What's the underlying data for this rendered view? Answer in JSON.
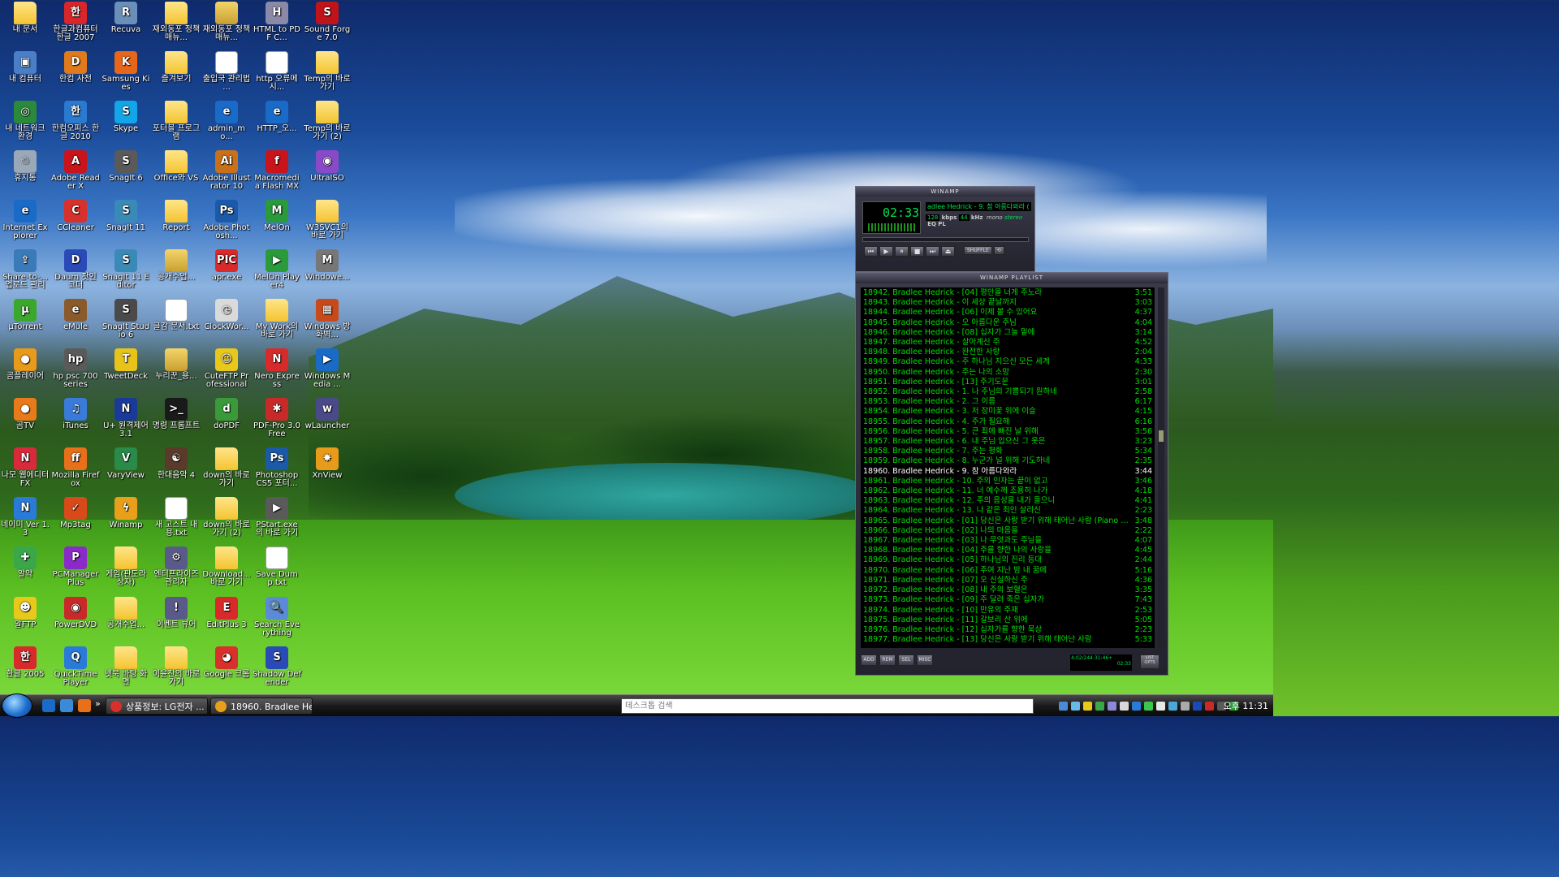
{
  "desktop": {
    "icons": [
      {
        "label": "내 문서",
        "kind": "folder"
      },
      {
        "label": "한글과컴퓨터 한글 2007",
        "kind": "app",
        "color": "#d8262a",
        "glyph": "한"
      },
      {
        "label": "Recuva",
        "kind": "app",
        "color": "#6a8fb8",
        "glyph": "R"
      },
      {
        "label": "재외동포 정책 매뉴...",
        "kind": "folder"
      },
      {
        "label": "재외동포 정책 매뉴...",
        "kind": "zip"
      },
      {
        "label": "HTML to PDF C...",
        "kind": "app",
        "color": "#8a8aa8",
        "glyph": "H"
      },
      {
        "label": "Sound Forge 7.0",
        "kind": "app",
        "color": "#c0141a",
        "glyph": "S"
      },
      {
        "label": "내 컴퓨터",
        "kind": "app",
        "color": "#4a7fc8",
        "glyph": "▣"
      },
      {
        "label": "한컴 사전",
        "kind": "app",
        "color": "#e07a1a",
        "glyph": "D"
      },
      {
        "label": "Samsung Kies",
        "kind": "app",
        "color": "#e8661a",
        "glyph": "K"
      },
      {
        "label": "즐겨보기",
        "kind": "folder"
      },
      {
        "label": "출입국 관리법 ...",
        "kind": "doc"
      },
      {
        "label": "http 오류메시...",
        "kind": "doc"
      },
      {
        "label": "Temp의 바로 가기",
        "kind": "folder"
      },
      {
        "label": "내 네트워크 환경",
        "kind": "app",
        "color": "#2a8a3a",
        "glyph": "◎"
      },
      {
        "label": "한컴오피스 한글 2010",
        "kind": "app",
        "color": "#2a7ad0",
        "glyph": "한"
      },
      {
        "label": "Skype",
        "kind": "app",
        "color": "#12a5e8",
        "glyph": "S"
      },
      {
        "label": "포터블 프로그램",
        "kind": "folder"
      },
      {
        "label": "admin_mo...",
        "kind": "app",
        "color": "#1a6ac8",
        "glyph": "e"
      },
      {
        "label": "HTTP_오...",
        "kind": "app",
        "color": "#1a6ac8",
        "glyph": "e"
      },
      {
        "label": "Temp의 바로 가기 (2)",
        "kind": "folder"
      },
      {
        "label": "휴지통",
        "kind": "app",
        "color": "#9aa8b8",
        "glyph": "♲"
      },
      {
        "label": "Adobe Reader X",
        "kind": "app",
        "color": "#c8141a",
        "glyph": "A"
      },
      {
        "label": "SnagIt 6",
        "kind": "app",
        "color": "#5a5a5a",
        "glyph": "S"
      },
      {
        "label": "Office와 VS",
        "kind": "folder"
      },
      {
        "label": "Adobe Illustrator 10",
        "kind": "app",
        "color": "#c8701a",
        "glyph": "Ai"
      },
      {
        "label": "Macromedia Flash MX",
        "kind": "app",
        "color": "#c8141a",
        "glyph": "f"
      },
      {
        "label": "UltraISO",
        "kind": "app",
        "color": "#8a4ac8",
        "glyph": "◉"
      },
      {
        "label": "Internet Explorer",
        "kind": "app",
        "color": "#1a6ac8",
        "glyph": "e"
      },
      {
        "label": "CCleaner",
        "kind": "app",
        "color": "#d8302a",
        "glyph": "C"
      },
      {
        "label": "SnagIt 11",
        "kind": "app",
        "color": "#3a8ab8",
        "glyph": "S"
      },
      {
        "label": "Report",
        "kind": "folder"
      },
      {
        "label": "Adobe Photosh...",
        "kind": "app",
        "color": "#1a5aa8",
        "glyph": "Ps"
      },
      {
        "label": "MelOn",
        "kind": "app",
        "color": "#2a9a3a",
        "glyph": "M"
      },
      {
        "label": "W3SVC1의 바로 가기",
        "kind": "folder"
      },
      {
        "label": "Share-to-... 업로드 관리",
        "kind": "app",
        "color": "#3a7ab8",
        "glyph": "⇪"
      },
      {
        "label": "Daum 팟인코더",
        "kind": "app",
        "color": "#2a4ab8",
        "glyph": "D"
      },
      {
        "label": "SnagIt 11 Editor",
        "kind": "app",
        "color": "#3a8ab8",
        "glyph": "S"
      },
      {
        "label": "공개수업...",
        "kind": "zip"
      },
      {
        "label": "apr.exe",
        "kind": "app",
        "color": "#d82a2a",
        "glyph": "PIC"
      },
      {
        "label": "MelOn Player4",
        "kind": "app",
        "color": "#2a9a3a",
        "glyph": "▶"
      },
      {
        "label": "Windowe...",
        "kind": "app",
        "color": "#777777",
        "glyph": "M"
      },
      {
        "label": "µTorrent",
        "kind": "app",
        "color": "#3aa82a",
        "glyph": "µ"
      },
      {
        "label": "eMule",
        "kind": "app",
        "color": "#8a5a2a",
        "glyph": "e"
      },
      {
        "label": "SnagIt Studio 6",
        "kind": "app",
        "color": "#4a4a4a",
        "glyph": "S"
      },
      {
        "label": "글감 문서.txt",
        "kind": "doc"
      },
      {
        "label": "ClockWor...",
        "kind": "app",
        "color": "#dadada",
        "glyph": "◷"
      },
      {
        "label": "My Work의 바로 가기",
        "kind": "folder"
      },
      {
        "label": "Windows 방화벽...",
        "kind": "app",
        "color": "#c84a1a",
        "glyph": "▦"
      },
      {
        "label": "곰플레이어",
        "kind": "app",
        "color": "#e89a1a",
        "glyph": "●"
      },
      {
        "label": "hp psc 700 series",
        "kind": "app",
        "color": "#5a5a5a",
        "glyph": "hp"
      },
      {
        "label": "TweetDeck",
        "kind": "app",
        "color": "#e8c41a",
        "glyph": "T"
      },
      {
        "label": "누리꾼_용...",
        "kind": "zip"
      },
      {
        "label": "CuteFTP Professional",
        "kind": "app",
        "color": "#e8c81a",
        "glyph": "☺"
      },
      {
        "label": "Nero Express",
        "kind": "app",
        "color": "#d82a2a",
        "glyph": "N"
      },
      {
        "label": "Windows Media ...",
        "kind": "app",
        "color": "#1a6ac8",
        "glyph": "▶"
      },
      {
        "label": "곰TV",
        "kind": "app",
        "color": "#e87a1a",
        "glyph": "●"
      },
      {
        "label": "iTunes",
        "kind": "app",
        "color": "#3a7ad8",
        "glyph": "♫"
      },
      {
        "label": "U+ 원격제어 3.1",
        "kind": "app",
        "color": "#1a3a9a",
        "glyph": "N"
      },
      {
        "label": "명령 프롬프트",
        "kind": "app",
        "color": "#1a1a1a",
        "glyph": ">_"
      },
      {
        "label": "doPDF",
        "kind": "app",
        "color": "#3a9a3a",
        "glyph": "d"
      },
      {
        "label": "PDF-Pro 3.0 Free",
        "kind": "app",
        "color": "#c82a2a",
        "glyph": "✱"
      },
      {
        "label": "wLauncher",
        "kind": "app",
        "color": "#4a4a8a",
        "glyph": "w"
      },
      {
        "label": "나모 웹에디터 FX",
        "kind": "app",
        "color": "#d82a3a",
        "glyph": "N"
      },
      {
        "label": "Mozilla Firefox",
        "kind": "app",
        "color": "#e8701a",
        "glyph": "ff"
      },
      {
        "label": "VaryView",
        "kind": "app",
        "color": "#2a8a4a",
        "glyph": "V"
      },
      {
        "label": "한대음악 4",
        "kind": "app",
        "color": "#5a3a2a",
        "glyph": "☯"
      },
      {
        "label": "down의 바로 가기",
        "kind": "folder"
      },
      {
        "label": "Photoshop CS5 포터...",
        "kind": "app",
        "color": "#1a5aa8",
        "glyph": "Ps"
      },
      {
        "label": "XnView",
        "kind": "app",
        "color": "#e89a1a",
        "glyph": "✸"
      },
      {
        "label": "네이미 Ver 1.3",
        "kind": "app",
        "color": "#2a7ad8",
        "glyph": "N"
      },
      {
        "label": "Mp3tag",
        "kind": "app",
        "color": "#d84a1a",
        "glyph": "✓"
      },
      {
        "label": "Winamp",
        "kind": "app",
        "color": "#e8a01a",
        "glyph": "ϟ"
      },
      {
        "label": "새 고스트 내용.txt",
        "kind": "doc"
      },
      {
        "label": "down의 바로 가기 (2)",
        "kind": "folder"
      },
      {
        "label": "PStart.exe의 바로 가기",
        "kind": "app",
        "color": "#5a5a5a",
        "glyph": "▶"
      },
      {
        "label": "알약",
        "kind": "app",
        "color": "#3aa84a",
        "glyph": "✚"
      },
      {
        "label": "PCManager Plus",
        "kind": "app",
        "color": "#8a2ac8",
        "glyph": "P"
      },
      {
        "label": "게임(판도라 상자)",
        "kind": "folder"
      },
      {
        "label": "엔터프라이즈 관리자",
        "kind": "app",
        "color": "#5a5a8a",
        "glyph": "⚙"
      },
      {
        "label": "Download... 바로 가기",
        "kind": "folder"
      },
      {
        "label": "Save Dump.txt",
        "kind": "doc"
      },
      {
        "label": "알FTP",
        "kind": "app",
        "color": "#e8c81a",
        "glyph": "☻"
      },
      {
        "label": "PowerDVD",
        "kind": "app",
        "color": "#c82a2a",
        "glyph": "◉"
      },
      {
        "label": "공개수업...",
        "kind": "folder"
      },
      {
        "label": "이벤트 뷰어",
        "kind": "app",
        "color": "#5a5a8a",
        "glyph": "!"
      },
      {
        "label": "EditPlus 3",
        "kind": "app",
        "color": "#d82a2a",
        "glyph": "E"
      },
      {
        "label": "Search Everything",
        "kind": "app",
        "color": "#5a8ad8",
        "glyph": "🔍"
      },
      {
        "label": "한글 2005",
        "kind": "app",
        "color": "#d82a2a",
        "glyph": "한"
      },
      {
        "label": "QuickTime Player",
        "kind": "app",
        "color": "#2a7ad8",
        "glyph": "Q"
      },
      {
        "label": "넷북 바탕 화면",
        "kind": "folder"
      },
      {
        "label": "이윤찬의 바로 가기",
        "kind": "folder"
      },
      {
        "label": "Google 크롬",
        "kind": "app",
        "color": "#d8302a",
        "glyph": "◕"
      },
      {
        "label": "Shadow Defender",
        "kind": "app",
        "color": "#2a4ab8",
        "glyph": "S"
      }
    ]
  },
  "winamp": {
    "title": "WINAMP",
    "time": "02:33",
    "song": "adlee Hedrick - 9. 참 아름다와라 (",
    "kbps": "128",
    "khz": "44",
    "kbps_label": "kbps",
    "khz_label": "kHz",
    "mono": "mono",
    "stereo": "stereo",
    "eq": "EQ",
    "pl": "PL",
    "shuffle": "SHUFFLE",
    "repeat": "⟲",
    "buttons": [
      "⏮",
      "▶",
      "⏸",
      "■",
      "⏭"
    ],
    "eject": "⏏"
  },
  "playlist": {
    "title": "WINAMP PLAYLIST",
    "current_index": 18,
    "tracks": [
      {
        "t": "18942. Bradlee Hedrick - [04] 평안을 너게 주노라",
        "d": "3:51"
      },
      {
        "t": "18943. Bradlee Hedrick - 이 세상 끝날까지",
        "d": "3:03"
      },
      {
        "t": "18944. Bradlee Hedrick - [06] 이제 볼 수 있어요",
        "d": "4:37"
      },
      {
        "t": "18945. Bradlee Hedrick - 오 아름다운 주님",
        "d": "4:04"
      },
      {
        "t": "18946. Bradlee Hedrick - [08] 십자가 그늘 밑에",
        "d": "3:14"
      },
      {
        "t": "18947. Bradlee Hedrick - 살아계신 주",
        "d": "4:52"
      },
      {
        "t": "18948. Bradlee Hedrick - 완전한 사랑",
        "d": "2:04"
      },
      {
        "t": "18949. Bradlee Hedrick - 주 하나님 지으신 모든 세계",
        "d": "4:33"
      },
      {
        "t": "18950. Bradlee Hedrick - 주는 나의 소망",
        "d": "2:30"
      },
      {
        "t": "18951. Bradlee Hedrick - [13] 주기도문",
        "d": "3:01"
      },
      {
        "t": "18952. Bradlee Hedrick - 1. 나 주님의 기쁨되기 원하네",
        "d": "2:58"
      },
      {
        "t": "18953. Bradlee Hedrick - 2. 그 이름",
        "d": "6:17"
      },
      {
        "t": "18954. Bradlee Hedrick - 3. 저 장미꽃 위에 이슬",
        "d": "4:15"
      },
      {
        "t": "18955. Bradlee Hedrick - 4. 주가 필요해",
        "d": "6:16"
      },
      {
        "t": "18956. Bradlee Hedrick - 5. 큰 죄에 빠진 날 위해",
        "d": "3:56"
      },
      {
        "t": "18957. Bradlee Hedrick - 6. 내 주님 입으신 그 옷은",
        "d": "3:23"
      },
      {
        "t": "18958. Bradlee Hedrick - 7. 주는 평화",
        "d": "5:34"
      },
      {
        "t": "18959. Bradlee Hedrick - 8. 누군가 널 위해 기도하네",
        "d": "2:35"
      },
      {
        "t": "18960. Bradlee Hedrick - 9. 참 아름다와라",
        "d": "3:44"
      },
      {
        "t": "18961. Bradlee Hedrick - 10. 주의 인자는 끝이 없고",
        "d": "3:46"
      },
      {
        "t": "18962. Bradlee Hedrick - 11. 너 예수께 조용히 나가",
        "d": "4:18"
      },
      {
        "t": "18963. Bradlee Hedrick - 12. 주의 음성을 내가 들으니",
        "d": "4:41"
      },
      {
        "t": "18964. Bradlee Hedrick - 13. 나 같은 죄인 살리신",
        "d": "2:23"
      },
      {
        "t": "18965. Bradlee Hedrick - [01] 당신은 사랑 받기 위해 태어난 사람 (Piano So...",
        "d": "3:48"
      },
      {
        "t": "18966. Bradlee Hedrick - [02] 나의 마음을",
        "d": "2:22"
      },
      {
        "t": "18967. Bradlee Hedrick - [03] 나 무엇과도 주님을",
        "d": "4:07"
      },
      {
        "t": "18968. Bradlee Hedrick - [04] 주를 향한 나의 사랑을",
        "d": "4:45"
      },
      {
        "t": "18969. Bradlee Hedrick - [05] 하나님의 진리 등대",
        "d": "2:44"
      },
      {
        "t": "18970. Bradlee Hedrick - [06] 주여 지난 밤 내 꿈에",
        "d": "5:16"
      },
      {
        "t": "18971. Bradlee Hedrick - [07] 오 신실하신 주",
        "d": "4:36"
      },
      {
        "t": "18972. Bradlee Hedrick - [08] 내 주의 보혈은",
        "d": "3:35"
      },
      {
        "t": "18973. Bradlee Hedrick - [09] 주 달려 죽은 십자가",
        "d": "7:43"
      },
      {
        "t": "18974. Bradlee Hedrick - [10] 만유의 주재",
        "d": "2:53"
      },
      {
        "t": "18975. Bradlee Hedrick - [11] 갈보리 산 위에",
        "d": "5:05"
      },
      {
        "t": "18976. Bradlee Hedrick - [12] 십자가를 향한 묵상",
        "d": "2:23"
      },
      {
        "t": "18977. Bradlee Hedrick - [13] 당신은 사랑 받기 위해 태어난 사람",
        "d": "5:33"
      }
    ],
    "footer": [
      "ADD",
      "REM",
      "SEL",
      "MISC"
    ],
    "info": "4:02/244:31:46+",
    "time": "02:33",
    "list_btn": "LIST OPTS"
  },
  "taskbar": {
    "tasks": [
      "상품정보: LG전자 ...",
      "18960. Bradlee Hed..."
    ],
    "search_placeholder": "데스크톱 검색",
    "clock": "오후 11:31",
    "more": "»"
  }
}
